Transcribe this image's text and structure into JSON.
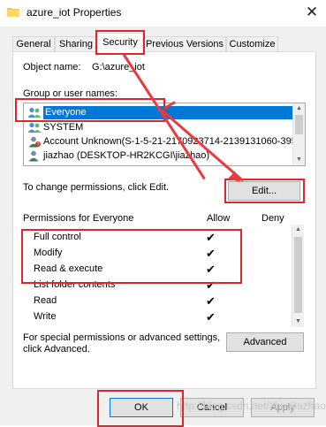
{
  "window": {
    "title": "azure_iot Properties",
    "close_icon": "close-icon"
  },
  "tabs": [
    {
      "label": "General",
      "active": false
    },
    {
      "label": "Sharing",
      "active": false
    },
    {
      "label": "Security",
      "active": true
    },
    {
      "label": "Previous Versions",
      "active": false
    },
    {
      "label": "Customize",
      "active": false
    }
  ],
  "security": {
    "object_name_label": "Object name:",
    "object_name_value": "G:\\azure_iot",
    "group_label": "Group or user names:",
    "groups": [
      {
        "name": "Everyone",
        "icon": "users-icon",
        "selected": true
      },
      {
        "name": "SYSTEM",
        "icon": "users-icon",
        "selected": false
      },
      {
        "name": "Account Unknown(S-1-5-21-2170923714-2139131060-395",
        "icon": "user-unknown-icon",
        "selected": false
      },
      {
        "name": "jiazhao (DESKTOP-HR2KCGI\\jiazhao)",
        "icon": "user-icon",
        "selected": false
      }
    ],
    "change_text": "To change permissions, click Edit.",
    "edit_button": "Edit...",
    "permissions_label": "Permissions for Everyone",
    "allow_header": "Allow",
    "deny_header": "Deny",
    "permissions": [
      {
        "name": "Full control",
        "allow": "✔",
        "deny": ""
      },
      {
        "name": "Modify",
        "allow": "✔",
        "deny": ""
      },
      {
        "name": "Read & execute",
        "allow": "✔",
        "deny": ""
      },
      {
        "name": "List folder contents",
        "allow": "✔",
        "deny": ""
      },
      {
        "name": "Read",
        "allow": "✔",
        "deny": ""
      },
      {
        "name": "Write",
        "allow": "✔",
        "deny": ""
      }
    ],
    "advanced_text": "For special permissions or advanced settings, click Advanced.",
    "advanced_button": "Advanced"
  },
  "footer": {
    "ok_button": "OK",
    "cancel_button": "Cancel",
    "apply_button": "Apply"
  },
  "watermark": "http://blog.csdn.net/zhoujiazhao",
  "colors": {
    "annotation_red": "#e0262b",
    "selection_blue": "#0078d7"
  }
}
